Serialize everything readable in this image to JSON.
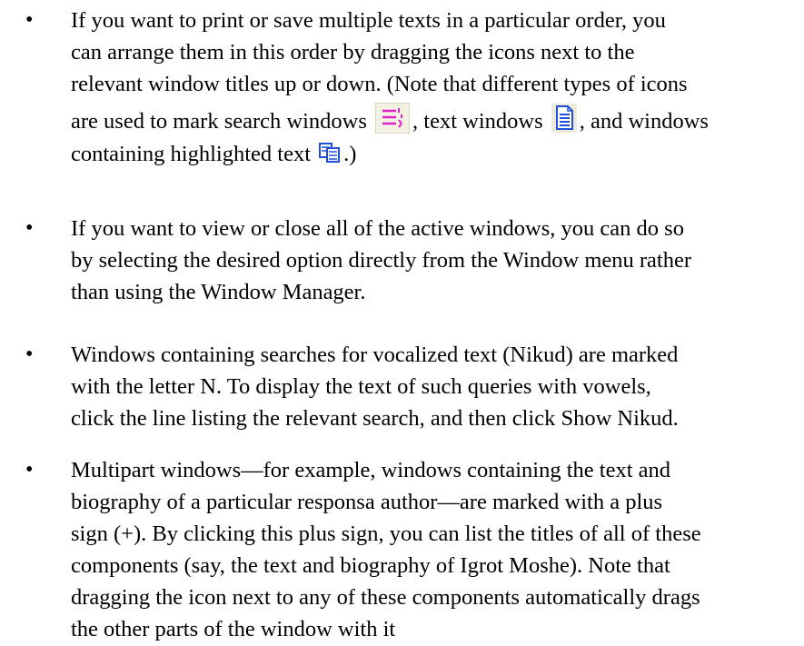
{
  "bullets": [
    {
      "symbol": "•",
      "lines": [
        "If you want to print or save multiple texts in a particular order, you",
        "can arrange them in this order by dragging the icons next to the",
        "relevant window titles up or down. (Note that different types of icons"
      ],
      "line4": {
        "before_search_icon": "are used to mark search windows",
        "after_search_icon": ", text windows",
        "after_text_icon": ", and windows"
      },
      "line5": {
        "before_icon": "containing highlighted text",
        "after_icon": ".)"
      }
    },
    {
      "symbol": "•",
      "lines": [
        "If you want to view or close all of the active windows, you can do so",
        "by selecting the desired option directly from the Window menu rather",
        "than using the Window Manager."
      ]
    },
    {
      "symbol": "•",
      "lines": [
        "Windows containing searches for vocalized text (Nikud) are marked",
        "with the letter N. To display the text of such queries with vowels,",
        "click the line listing the relevant search, and then click Show Nikud."
      ]
    },
    {
      "symbol": "•",
      "lines": [
        "Multipart windows—for example, windows containing the text and",
        "biography of a particular responsa author—are marked with a plus",
        "sign (+). By clicking this plus sign, you can list the titles of all of these",
        "components (say, the text and biography of Igrot Moshe). Note that",
        "dragging the icon next to any of these components automatically drags",
        "the other parts of the window with it"
      ]
    }
  ],
  "icons": {
    "search_window": "search-window-icon",
    "text_window": "text-window-icon",
    "highlighted_text_window": "highlighted-text-window-icon"
  },
  "colors": {
    "search_icon_lines": "#e020c8",
    "text_icon_blue": "#1f4fd6",
    "icon_bg": "#ece9d8"
  }
}
